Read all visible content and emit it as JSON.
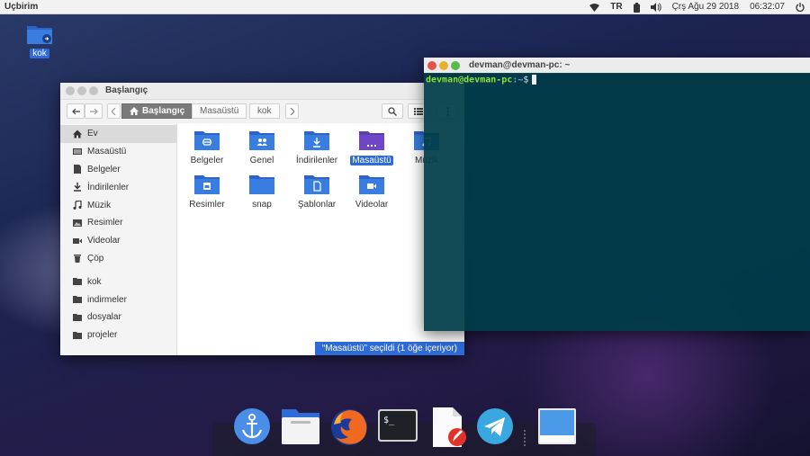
{
  "top_panel": {
    "app_name": "Uçbirim",
    "keyboard": "TR",
    "datetime": "Çrş Ağu 29 2018",
    "clock": "06:32:07"
  },
  "desktop": {
    "icon_label": "kok"
  },
  "file_manager": {
    "title": "Başlangıç",
    "breadcrumbs": [
      "Başlangıç",
      "Masaüstü",
      "kok"
    ],
    "sidebar": [
      "Ev",
      "Masaüstü",
      "Belgeler",
      "İndirilenler",
      "Müzik",
      "Resimler",
      "Videolar",
      "Çöp",
      "kok",
      "indirmeler",
      "dosyalar",
      "projeler"
    ],
    "folders": [
      "Belgeler",
      "Genel",
      "İndirilenler",
      "Masaüstü",
      "Müzik",
      "Resimler",
      "snap",
      "Şablonlar",
      "Videolar"
    ],
    "status": "“Masaüstü” seçildi  (1 öğe içeriyor)"
  },
  "terminal": {
    "title": "devman@devman-pc: ~",
    "prompt_user": "devman@devman-pc",
    "prompt_path": ":~",
    "prompt_symbol": "$"
  },
  "colors": {
    "accent": "#2e6bd6",
    "folder": "#3a7de0",
    "terminal_bg": "#003c48"
  }
}
